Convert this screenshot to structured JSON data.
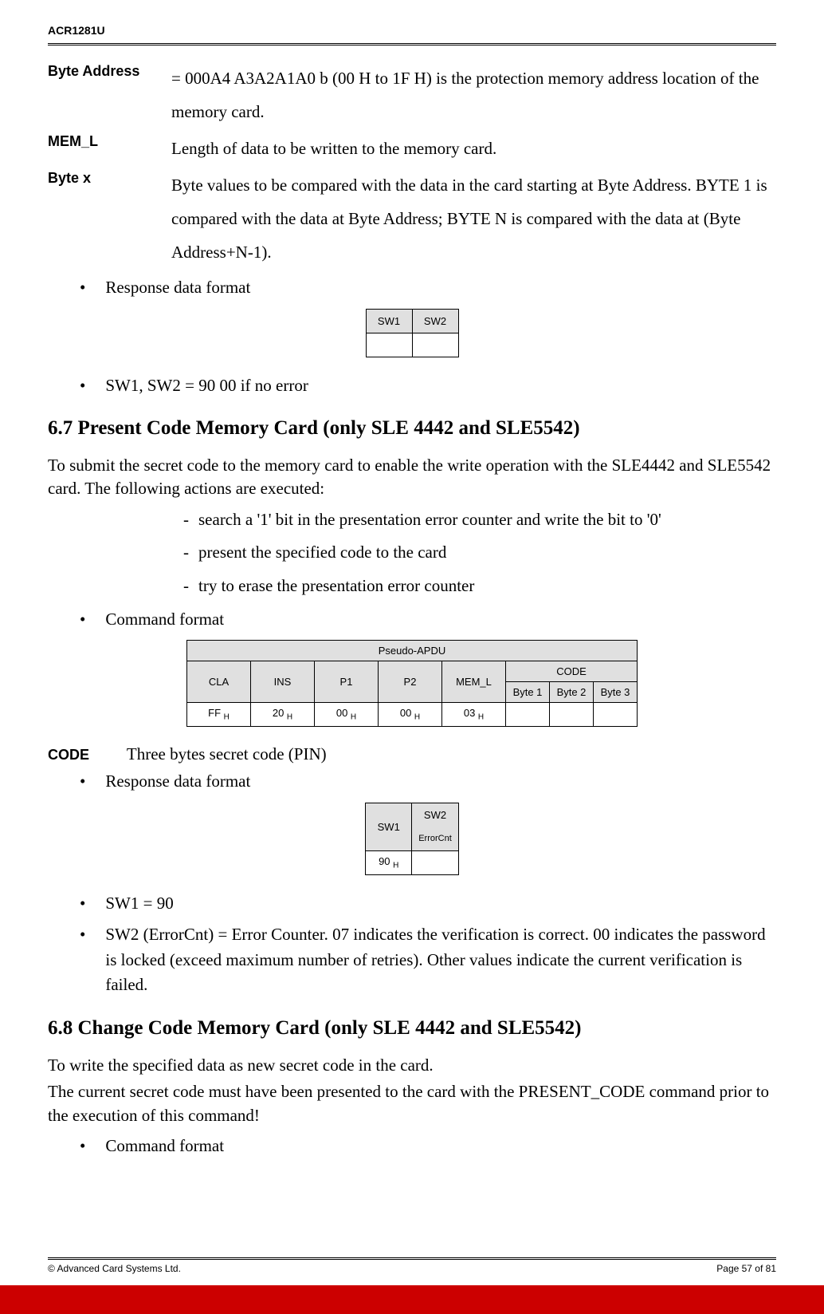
{
  "header": {
    "doc_id": "ACR1281U"
  },
  "defs": {
    "byte_address": {
      "label": "Byte Address",
      "text": "= 000A4 A3A2A1A0 b (00 H to 1F H) is the protection memory address location of the memory card."
    },
    "mem_l": {
      "label": "MEM_L",
      "text": "Length of data to be written to the memory card."
    },
    "byte_x": {
      "label": "Byte x",
      "text": "Byte values to be compared with the data in the card starting at Byte Address. BYTE 1 is compared with the data at Byte Address; BYTE N is compared with the data at (Byte Address+N-1)."
    }
  },
  "bullets": {
    "resp1": "Response data format",
    "cmd": "Command format",
    "resp2": "Response data format",
    "cmd2": "Command format",
    "sw_desc": "SW1, SW2      = 90  00  if no error",
    "sw1_90": "SW1 = 90",
    "sw2_err": "SW2 (ErrorCnt) = Error Counter.  07 indicates the verification is correct.  00 indicates the password is locked (exceed maximum number of retries).  Other values indicate the current verification is failed."
  },
  "sw_table": {
    "h1": "SW1",
    "h2": "SW2"
  },
  "section67": {
    "title": "6.7 Present Code Memory Card (only SLE 4442 and SLE5542)",
    "intro": "To submit the secret code to the memory card to enable the write operation with the SLE4442 and SLE5542 card. The following actions are executed:",
    "dash1": "search a '1' bit in the presentation error counter and write the bit to '0'",
    "dash2": "present the specified code to the card",
    "dash3": "try to erase the presentation error counter"
  },
  "apdu": {
    "top": "Pseudo-APDU",
    "cla": "CLA",
    "ins": "INS",
    "p1": "P1",
    "p2": "P2",
    "mem_l": "MEM_L",
    "code": "CODE",
    "b1": "Byte 1",
    "b2": "Byte 2",
    "b3": "Byte 3",
    "vcla": "FF ",
    "vins": "20 ",
    "vp1": "00 ",
    "vp2": "00 ",
    "vmem": "03 "
  },
  "code_def": {
    "label": "CODE",
    "text": "Three bytes secret code (PIN)"
  },
  "sw_table2": {
    "h1": "SW1",
    "h2": "SW2",
    "sub": "ErrorCnt",
    "v1": "90 "
  },
  "section68": {
    "title": "6.8 Change Code Memory Card (only SLE 4442 and SLE5542)",
    "p1": "To write the specified data as new secret code in the card.",
    "p2": "The current secret code must have been presented to the card with the PRESENT_CODE command prior to the execution of this command!"
  },
  "footer": {
    "left": "© Advanced Card Systems Ltd.",
    "right": "Page 57 of 81"
  }
}
